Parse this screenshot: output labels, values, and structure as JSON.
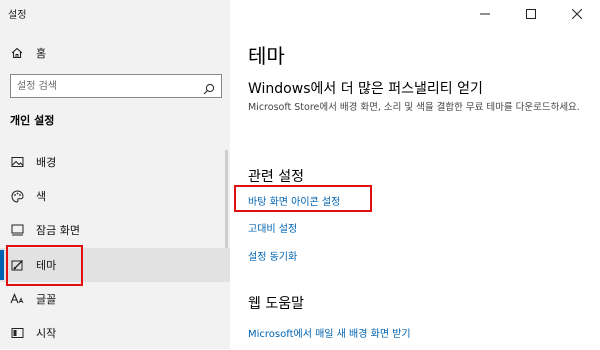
{
  "window": {
    "title": "설정"
  },
  "sidebar": {
    "home_label": "홈",
    "search_placeholder": "설정 검색",
    "section_title": "개인 설정",
    "items": [
      {
        "label": "배경",
        "icon": "picture-icon"
      },
      {
        "label": "색",
        "icon": "palette-icon"
      },
      {
        "label": "잠금 화면",
        "icon": "lock-screen-icon"
      },
      {
        "label": "테마",
        "icon": "theme-brush-icon",
        "selected": true
      },
      {
        "label": "글꼴",
        "icon": "font-icon"
      },
      {
        "label": "시작",
        "icon": "start-icon"
      }
    ]
  },
  "main": {
    "page_title": "테마",
    "store_heading": "Windows에서 더 많은 퍼스낼리티 얻기",
    "store_description": "Microsoft Store에서 배경 화면, 소리 및 색을 결합한 무료 테마를 다운로드하세요.",
    "related_heading": "관련 설정",
    "related_links": [
      "바탕 화면 아이콘 설정",
      "고대비 설정",
      "설정 동기화"
    ],
    "help_heading": "웹 도움말",
    "help_link": "Microsoft에서 매일 새 배경 화면 받기"
  },
  "colors": {
    "accent": "#0063b1",
    "highlight_box": "#e01010",
    "sidebar_bg": "#f2f2f2"
  }
}
